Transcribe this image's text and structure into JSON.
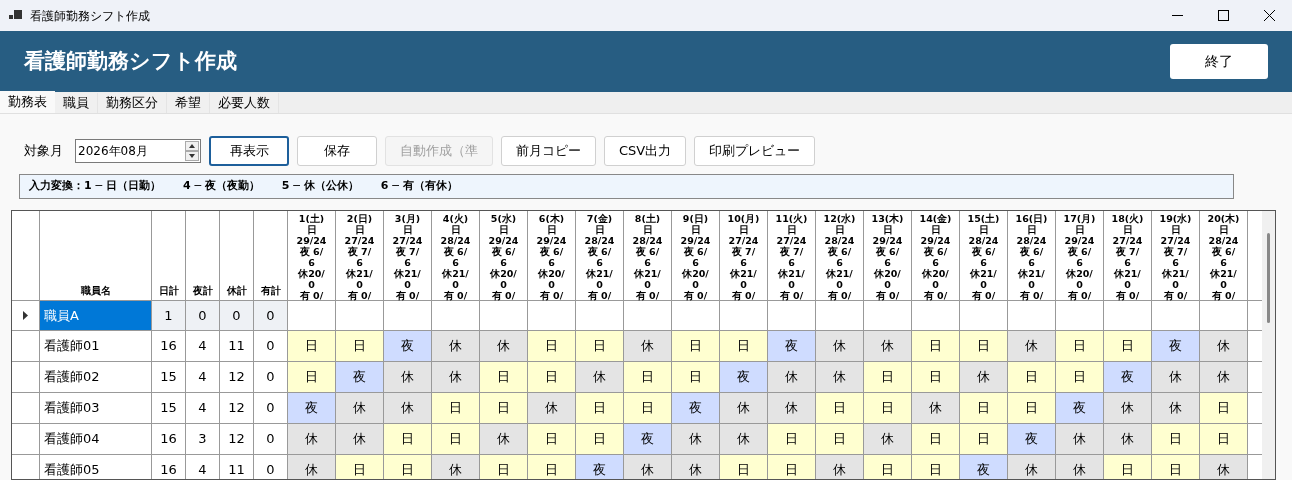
{
  "window": {
    "title": "看護師勤務シフト作成"
  },
  "header": {
    "title": "看護師勤務シフト作成",
    "exit_button": "終了"
  },
  "tabs": [
    {
      "label": "勤務表",
      "selected": true
    },
    {
      "label": "職員",
      "selected": false
    },
    {
      "label": "勤務区分",
      "selected": false
    },
    {
      "label": "希望",
      "selected": false
    },
    {
      "label": "必要人数",
      "selected": false
    }
  ],
  "toolbar": {
    "month_label": "対象月",
    "month_value": "2026年08月",
    "buttons": [
      {
        "label": "再表示",
        "disabled": false,
        "focused": true
      },
      {
        "label": "保存",
        "disabled": false,
        "focused": false
      },
      {
        "label": "自動作成（準",
        "disabled": true,
        "focused": false
      },
      {
        "label": "前月コピー",
        "disabled": false,
        "focused": false
      },
      {
        "label": "CSV出力",
        "disabled": false,
        "focused": false
      },
      {
        "label": "印刷プレビュー",
        "disabled": false,
        "focused": false
      }
    ]
  },
  "legend": "入力変換：1 ─ 日（日勤）　　4 ─ 夜（夜勤）　　5 ─ 休（公休）　　6 ─ 有（有休）",
  "grid": {
    "name_column": "職員名",
    "total_columns": [
      "日計",
      "夜計",
      "休計",
      "有計"
    ],
    "days": [
      {
        "lines": [
          "1(土)",
          "日",
          "29/24",
          "夜 6/",
          "6",
          "休20/",
          "0",
          "有 0/"
        ]
      },
      {
        "lines": [
          "2(日)",
          "日",
          "27/24",
          "夜 7/",
          "6",
          "休21/",
          "0",
          "有 0/"
        ]
      },
      {
        "lines": [
          "3(月)",
          "日",
          "27/24",
          "夜 7/",
          "6",
          "休21/",
          "0",
          "有 0/"
        ]
      },
      {
        "lines": [
          "4(火)",
          "日",
          "28/24",
          "夜 6/",
          "6",
          "休21/",
          "0",
          "有 0/"
        ]
      },
      {
        "lines": [
          "5(水)",
          "日",
          "29/24",
          "夜 6/",
          "6",
          "休20/",
          "0",
          "有 0/"
        ]
      },
      {
        "lines": [
          "6(木)",
          "日",
          "29/24",
          "夜 6/",
          "6",
          "休20/",
          "0",
          "有 0/"
        ]
      },
      {
        "lines": [
          "7(金)",
          "日",
          "28/24",
          "夜 6/",
          "6",
          "休21/",
          "0",
          "有 0/"
        ]
      },
      {
        "lines": [
          "8(土)",
          "日",
          "28/24",
          "夜 6/",
          "6",
          "休21/",
          "0",
          "有 0/"
        ]
      },
      {
        "lines": [
          "9(日)",
          "日",
          "29/24",
          "夜 6/",
          "6",
          "休20/",
          "0",
          "有 0/"
        ]
      },
      {
        "lines": [
          "10(月)",
          "日",
          "27/24",
          "夜 7/",
          "6",
          "休21/",
          "0",
          "有 0/"
        ]
      },
      {
        "lines": [
          "11(火)",
          "日",
          "27/24",
          "夜 7/",
          "6",
          "休21/",
          "0",
          "有 0/"
        ]
      },
      {
        "lines": [
          "12(水)",
          "日",
          "28/24",
          "夜 6/",
          "6",
          "休21/",
          "0",
          "有 0/"
        ]
      },
      {
        "lines": [
          "13(木)",
          "日",
          "29/24",
          "夜 6/",
          "6",
          "休20/",
          "0",
          "有 0/"
        ]
      },
      {
        "lines": [
          "14(金)",
          "日",
          "29/24",
          "夜 6/",
          "6",
          "休20/",
          "0",
          "有 0/"
        ]
      },
      {
        "lines": [
          "15(土)",
          "日",
          "28/24",
          "夜 6/",
          "6",
          "休21/",
          "0",
          "有 0/"
        ]
      },
      {
        "lines": [
          "16(日)",
          "日",
          "28/24",
          "夜 6/",
          "6",
          "休21/",
          "0",
          "有 0/"
        ]
      },
      {
        "lines": [
          "17(月)",
          "日",
          "29/24",
          "夜 6/",
          "6",
          "休20/",
          "0",
          "有 0/"
        ]
      },
      {
        "lines": [
          "18(火)",
          "日",
          "27/24",
          "夜 7/",
          "6",
          "休21/",
          "0",
          "有 0/"
        ]
      },
      {
        "lines": [
          "19(水)",
          "日",
          "27/24",
          "夜 7/",
          "6",
          "休21/",
          "0",
          "有 0/"
        ]
      },
      {
        "lines": [
          "20(木)",
          "日",
          "28/24",
          "夜 6/",
          "6",
          "休21/",
          "0",
          "有 0/"
        ]
      }
    ],
    "rows": [
      {
        "name": "職員A",
        "selected": true,
        "totals": [
          "1",
          "0",
          "0",
          "0"
        ],
        "shifts": [
          {
            "kind": "empty"
          },
          {
            "kind": "empty"
          },
          {
            "kind": "empty"
          },
          {
            "kind": "empty"
          },
          {
            "kind": "empty"
          },
          {
            "kind": "empty"
          },
          {
            "kind": "empty"
          },
          {
            "kind": "empty"
          },
          {
            "kind": "empty"
          },
          {
            "kind": "empty"
          },
          {
            "kind": "empty"
          },
          {
            "kind": "empty"
          },
          {
            "kind": "empty"
          },
          {
            "kind": "empty"
          },
          {
            "kind": "empty"
          },
          {
            "kind": "empty"
          },
          {
            "kind": "empty"
          },
          {
            "kind": "empty"
          },
          {
            "kind": "empty"
          },
          {
            "kind": "empty"
          }
        ]
      },
      {
        "name": "看護師01",
        "selected": false,
        "totals": [
          "16",
          "4",
          "11",
          "0"
        ],
        "shifts": [
          {
            "text": "日",
            "kind": "day"
          },
          {
            "text": "日",
            "kind": "day"
          },
          {
            "text": "夜",
            "kind": "night"
          },
          {
            "text": "休",
            "kind": "off"
          },
          {
            "text": "休",
            "kind": "off"
          },
          {
            "text": "日",
            "kind": "day"
          },
          {
            "text": "日",
            "kind": "day"
          },
          {
            "text": "休",
            "kind": "off"
          },
          {
            "text": "日",
            "kind": "day"
          },
          {
            "text": "日",
            "kind": "day"
          },
          {
            "text": "夜",
            "kind": "night"
          },
          {
            "text": "休",
            "kind": "off"
          },
          {
            "text": "休",
            "kind": "off"
          },
          {
            "text": "日",
            "kind": "day"
          },
          {
            "text": "日",
            "kind": "day"
          },
          {
            "text": "休",
            "kind": "off"
          },
          {
            "text": "日",
            "kind": "day"
          },
          {
            "text": "日",
            "kind": "day"
          },
          {
            "text": "夜",
            "kind": "night"
          },
          {
            "text": "休",
            "kind": "off"
          }
        ]
      },
      {
        "name": "看護師02",
        "selected": false,
        "totals": [
          "15",
          "4",
          "12",
          "0"
        ],
        "shifts": [
          {
            "text": "日",
            "kind": "day"
          },
          {
            "text": "夜",
            "kind": "night"
          },
          {
            "text": "休",
            "kind": "off"
          },
          {
            "text": "休",
            "kind": "off"
          },
          {
            "text": "日",
            "kind": "day"
          },
          {
            "text": "日",
            "kind": "day"
          },
          {
            "text": "休",
            "kind": "off"
          },
          {
            "text": "日",
            "kind": "day"
          },
          {
            "text": "日",
            "kind": "day"
          },
          {
            "text": "夜",
            "kind": "night"
          },
          {
            "text": "休",
            "kind": "off"
          },
          {
            "text": "休",
            "kind": "off"
          },
          {
            "text": "日",
            "kind": "day"
          },
          {
            "text": "日",
            "kind": "day"
          },
          {
            "text": "休",
            "kind": "off"
          },
          {
            "text": "日",
            "kind": "day"
          },
          {
            "text": "日",
            "kind": "day"
          },
          {
            "text": "夜",
            "kind": "night"
          },
          {
            "text": "休",
            "kind": "off"
          },
          {
            "text": "休",
            "kind": "off"
          }
        ]
      },
      {
        "name": "看護師03",
        "selected": false,
        "totals": [
          "15",
          "4",
          "12",
          "0"
        ],
        "shifts": [
          {
            "text": "夜",
            "kind": "night"
          },
          {
            "text": "休",
            "kind": "off"
          },
          {
            "text": "休",
            "kind": "off"
          },
          {
            "text": "日",
            "kind": "day"
          },
          {
            "text": "日",
            "kind": "day"
          },
          {
            "text": "休",
            "kind": "off"
          },
          {
            "text": "日",
            "kind": "day"
          },
          {
            "text": "日",
            "kind": "day"
          },
          {
            "text": "夜",
            "kind": "night"
          },
          {
            "text": "休",
            "kind": "off"
          },
          {
            "text": "休",
            "kind": "off"
          },
          {
            "text": "日",
            "kind": "day"
          },
          {
            "text": "日",
            "kind": "day"
          },
          {
            "text": "休",
            "kind": "off"
          },
          {
            "text": "日",
            "kind": "day"
          },
          {
            "text": "日",
            "kind": "day"
          },
          {
            "text": "夜",
            "kind": "night"
          },
          {
            "text": "休",
            "kind": "off"
          },
          {
            "text": "休",
            "kind": "off"
          },
          {
            "text": "日",
            "kind": "day"
          }
        ]
      },
      {
        "name": "看護師04",
        "selected": false,
        "totals": [
          "16",
          "3",
          "12",
          "0"
        ],
        "shifts": [
          {
            "text": "休",
            "kind": "off"
          },
          {
            "text": "休",
            "kind": "off"
          },
          {
            "text": "日",
            "kind": "day"
          },
          {
            "text": "日",
            "kind": "day"
          },
          {
            "text": "休",
            "kind": "off"
          },
          {
            "text": "日",
            "kind": "day"
          },
          {
            "text": "日",
            "kind": "day"
          },
          {
            "text": "夜",
            "kind": "night"
          },
          {
            "text": "休",
            "kind": "off"
          },
          {
            "text": "休",
            "kind": "off"
          },
          {
            "text": "日",
            "kind": "day"
          },
          {
            "text": "日",
            "kind": "day"
          },
          {
            "text": "休",
            "kind": "off"
          },
          {
            "text": "日",
            "kind": "day"
          },
          {
            "text": "日",
            "kind": "day"
          },
          {
            "text": "夜",
            "kind": "night"
          },
          {
            "text": "休",
            "kind": "off"
          },
          {
            "text": "休",
            "kind": "off"
          },
          {
            "text": "日",
            "kind": "day"
          },
          {
            "text": "日",
            "kind": "day"
          }
        ]
      },
      {
        "name": "看護師05",
        "selected": false,
        "totals": [
          "16",
          "4",
          "11",
          "0"
        ],
        "shifts": [
          {
            "text": "休",
            "kind": "off"
          },
          {
            "text": "日",
            "kind": "day"
          },
          {
            "text": "日",
            "kind": "day"
          },
          {
            "text": "休",
            "kind": "off"
          },
          {
            "text": "日",
            "kind": "day"
          },
          {
            "text": "日",
            "kind": "day"
          },
          {
            "text": "夜",
            "kind": "night"
          },
          {
            "text": "休",
            "kind": "off"
          },
          {
            "text": "休",
            "kind": "off"
          },
          {
            "text": "日",
            "kind": "day"
          },
          {
            "text": "日",
            "kind": "day"
          },
          {
            "text": "休",
            "kind": "off"
          },
          {
            "text": "日",
            "kind": "day"
          },
          {
            "text": "日",
            "kind": "day"
          },
          {
            "text": "夜",
            "kind": "night"
          },
          {
            "text": "休",
            "kind": "off"
          },
          {
            "text": "休",
            "kind": "off"
          },
          {
            "text": "日",
            "kind": "day"
          },
          {
            "text": "日",
            "kind": "day"
          },
          {
            "text": "休",
            "kind": "off"
          }
        ]
      }
    ]
  }
}
